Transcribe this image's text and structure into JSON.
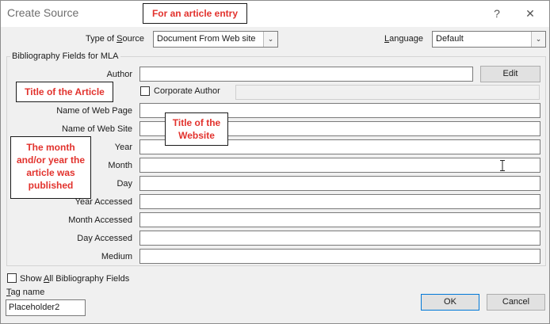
{
  "window": {
    "title": "Create Source",
    "help_glyph": "?",
    "close_glyph": "✕"
  },
  "type_of_source": {
    "label_pre": "Type of ",
    "label_acc": "S",
    "label_post": "ource",
    "value": "Document From Web site"
  },
  "language": {
    "label_acc": "L",
    "label_post": "anguage",
    "value": "Default"
  },
  "group_title": "Bibliography Fields for MLA",
  "author": {
    "label": "Author",
    "edit_label": "Edit"
  },
  "corporate_author": {
    "label": "Corporate Author"
  },
  "fields": {
    "web_page": "Name of Web Page",
    "web_site": "Name of Web Site",
    "year": "Year",
    "month": "Month",
    "day": "Day",
    "year_accessed": "Year Accessed",
    "month_accessed": "Month Accessed",
    "day_accessed": "Day Accessed",
    "medium": "Medium"
  },
  "show_all": {
    "label_pre": "Show ",
    "label_acc": "A",
    "label_post": "ll Bibliography Fields"
  },
  "tag": {
    "label_acc": "T",
    "label_post": "ag name",
    "value": "Placeholder2"
  },
  "buttons": {
    "ok": "OK",
    "cancel": "Cancel"
  },
  "annotations": {
    "article_entry": "For an article entry",
    "title_article": "Title of the Article",
    "title_website": "Title of the Website",
    "month_year": "The month and/or year the article was published"
  }
}
